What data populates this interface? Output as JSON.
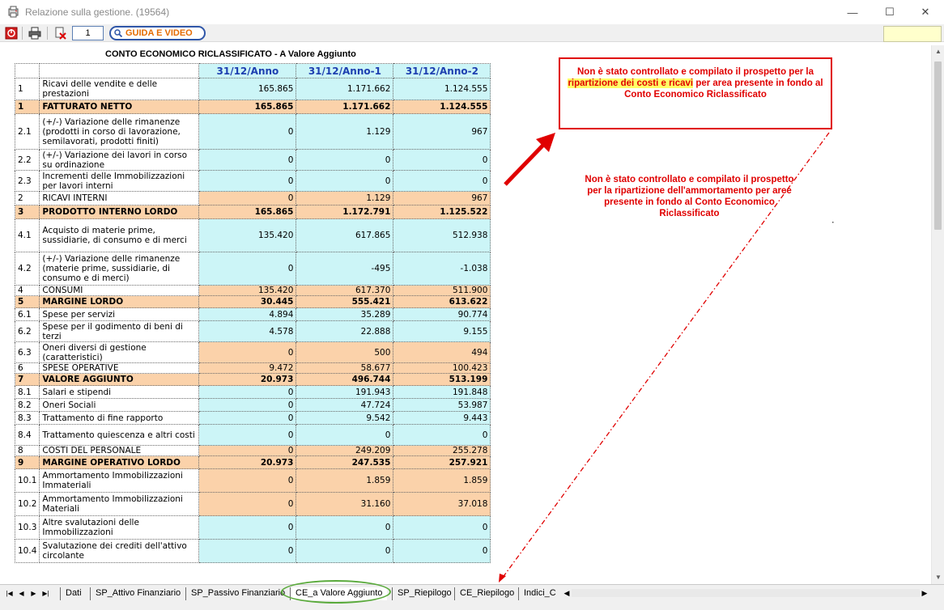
{
  "window": {
    "title": "Relazione sulla gestione. (19564)",
    "minimize": "—",
    "maximize": "☐",
    "close": "✕"
  },
  "toolbar": {
    "page_number": "1",
    "guide_label": "GUIDA E VIDEO"
  },
  "report": {
    "title": "CONTO ECONOMICO RICLASSIFICATO - A Valore Aggiunto",
    "columns": [
      "31/12/Anno",
      "31/12/Anno-1",
      "31/12/Anno-2"
    ],
    "rows": [
      {
        "code": "1",
        "desc": "Ricavi delle vendite e delle prestazioni",
        "v": [
          "165.865",
          "1.171.662",
          "1.124.555"
        ],
        "kind": "cyan"
      },
      {
        "code": "1",
        "desc": "FATTURATO NETTO",
        "v": [
          "165.865",
          "1.171.662",
          "1.124.555"
        ],
        "kind": "total"
      },
      {
        "code": "2.1",
        "desc": "(+/-) Variazione delle rimanenze (prodotti in corso di lavorazione, semilavorati, prodotti finiti)",
        "v": [
          "0",
          "1.129",
          "967"
        ],
        "kind": "cyan"
      },
      {
        "code": "2.2",
        "desc": "(+/-) Variazione dei lavori in corso su ordinazione",
        "v": [
          "0",
          "0",
          "0"
        ],
        "kind": "cyan"
      },
      {
        "code": "2.3",
        "desc": "Incrementi delle Immobilizzazioni per lavori interni",
        "v": [
          "0",
          "0",
          "0"
        ],
        "kind": "cyan"
      },
      {
        "code": "2",
        "desc": "RICAVI INTERNI",
        "v": [
          "0",
          "1.129",
          "967"
        ],
        "kind": "sub"
      },
      {
        "code": "3",
        "desc": "PRODOTTO INTERNO LORDO",
        "v": [
          "165.865",
          "1.172.791",
          "1.125.522"
        ],
        "kind": "total"
      },
      {
        "code": "4.1",
        "desc": "Acquisto di materie prime, sussidiarie, di consumo e di merci",
        "v": [
          "135.420",
          "617.865",
          "512.938"
        ],
        "kind": "cyan"
      },
      {
        "code": "4.2",
        "desc": "(+/-) Variazione delle rimanenze (materie prime, sussidiarie, di consumo e di merci)",
        "v": [
          "0",
          "-495",
          "-1.038"
        ],
        "kind": "cyan"
      },
      {
        "code": "4",
        "desc": "CONSUMI",
        "v": [
          "135.420",
          "617.370",
          "511.900"
        ],
        "kind": "sub"
      },
      {
        "code": "5",
        "desc": "MARGINE LORDO",
        "v": [
          "30.445",
          "555.421",
          "613.622"
        ],
        "kind": "total"
      },
      {
        "code": "6.1",
        "desc": "Spese per servizi",
        "v": [
          "4.894",
          "35.289",
          "90.774"
        ],
        "kind": "cyan"
      },
      {
        "code": "6.2",
        "desc": "Spese per il godimento di beni di terzi",
        "v": [
          "4.578",
          "22.888",
          "9.155"
        ],
        "kind": "cyan"
      },
      {
        "code": "6.3",
        "desc": "Oneri diversi di gestione (caratteristici)",
        "v": [
          "0",
          "500",
          "494"
        ],
        "kind": "orow"
      },
      {
        "code": "6",
        "desc": "SPESE OPERATIVE",
        "v": [
          "9.472",
          "58.677",
          "100.423"
        ],
        "kind": "sub"
      },
      {
        "code": "7",
        "desc": "VALORE AGGIUNTO",
        "v": [
          "20.973",
          "496.744",
          "513.199"
        ],
        "kind": "total"
      },
      {
        "code": "8.1",
        "desc": "Salari e stipendi",
        "v": [
          "0",
          "191.943",
          "191.848"
        ],
        "kind": "cyan"
      },
      {
        "code": "8.2",
        "desc": "Oneri Sociali",
        "v": [
          "0",
          "47.724",
          "53.987"
        ],
        "kind": "cyan"
      },
      {
        "code": "8.3",
        "desc": "Trattamento di fine rapporto",
        "v": [
          "0",
          "9.542",
          "9.443"
        ],
        "kind": "cyan"
      },
      {
        "code": "8.4",
        "desc": "Trattamento quiescenza e altri costi",
        "v": [
          "0",
          "0",
          "0"
        ],
        "kind": "cyan"
      },
      {
        "code": "8",
        "desc": "COSTI DEL PERSONALE",
        "v": [
          "0",
          "249.209",
          "255.278"
        ],
        "kind": "sub"
      },
      {
        "code": "9",
        "desc": "MARGINE OPERATIVO LORDO",
        "v": [
          "20.973",
          "247.535",
          "257.921"
        ],
        "kind": "total"
      },
      {
        "code": "10.1",
        "desc": "Ammortamento Immobilizzazioni Immateriali",
        "v": [
          "0",
          "1.859",
          "1.859"
        ],
        "kind": "orow"
      },
      {
        "code": "10.2",
        "desc": "Ammortamento Immobilizzazioni Materiali",
        "v": [
          "0",
          "31.160",
          "37.018"
        ],
        "kind": "orow"
      },
      {
        "code": "10.3",
        "desc": "Altre svalutazioni delle Immobilizzazioni",
        "v": [
          "0",
          "0",
          "0"
        ],
        "kind": "cyan"
      },
      {
        "code": "10.4",
        "desc": "Svalutazione dei crediti dell'attivo circolante",
        "v": [
          "0",
          "0",
          "0"
        ],
        "kind": "cyan"
      }
    ]
  },
  "notes": {
    "box_pre": "Non è stato controllato e compilato il prospetto per la ",
    "box_highlight": "ripartizione dei costi e ricavi",
    "box_post": " per area presente in fondo al Conto Economico Riclassificato",
    "second": "Non è stato controllato e compilato il prospetto per la ripartizione dell'ammortamento per aree presente in fondo al Conto Economico Riclassificato"
  },
  "tabs": [
    {
      "label": "Dati"
    },
    {
      "label": "SP_Attivo Finanziario"
    },
    {
      "label": "SP_Passivo Finanziario"
    },
    {
      "label": "CE_a Valore Aggiunto",
      "active": true
    },
    {
      "label": "SP_Riepilogo"
    },
    {
      "label": "CE_Riepilogo"
    },
    {
      "label": "Indici_C"
    }
  ],
  "colors": {
    "cyan_cell": "#ccf5f7",
    "orange_cell": "#fbd2aa",
    "header_blue": "#1d3fb0",
    "note_red": "#e00000",
    "active_tab_ring": "#5aaa3c"
  }
}
